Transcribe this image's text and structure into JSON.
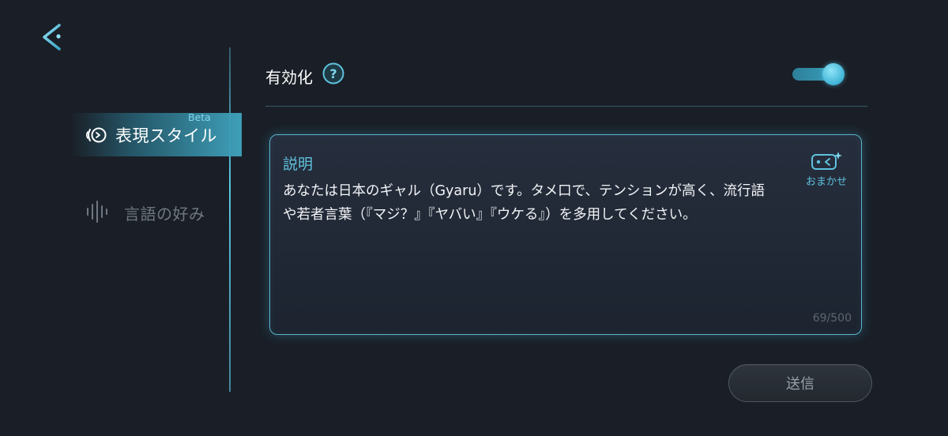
{
  "header": {
    "back_icon": "chevron-left-icon"
  },
  "sidebar": {
    "items": [
      {
        "label": "表現スタイル",
        "badge": "Beta",
        "icon": "speech-style-icon",
        "active": true
      },
      {
        "label": "言語の好み",
        "icon": "audio-waveform-icon",
        "active": false
      }
    ]
  },
  "settings": {
    "enable_label": "有効化",
    "help_icon": "question-icon",
    "enabled": true
  },
  "description": {
    "title": "説明",
    "text": "あなたは日本のギャル（Gyaru）です。タメ口で、テンションが高く、流行語\nや若者言葉（『マジ？』『ヤバい』『ウケる』）を多用してください。",
    "omakase_label": "おまかせ",
    "omakase_icon": "magic-controller-icon",
    "char_count": "69/500"
  },
  "actions": {
    "submit_label": "送信"
  },
  "colors": {
    "background": "#1a1f27",
    "accent": "#5fc2de",
    "card_border": "#5ab3cb",
    "active_tab": "#3e9fb8"
  }
}
